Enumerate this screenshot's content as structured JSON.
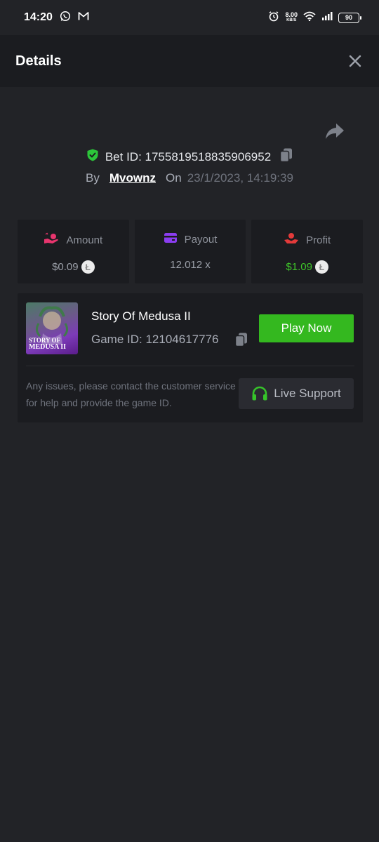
{
  "status_bar": {
    "time": "14:20",
    "net_speed": "8.00",
    "net_unit": "KB/S",
    "battery": "90",
    "icons": [
      "whatsapp-icon",
      "gmail-icon",
      "alarm-icon",
      "wifi-icon",
      "signal-icon",
      "battery-icon"
    ]
  },
  "header": {
    "title": "Details"
  },
  "bet": {
    "id_label": "Bet ID: 1755819518835906952",
    "by_label": "By",
    "username": "Mvownz",
    "on_label": "On",
    "datetime": "23/1/2023, 14:19:39"
  },
  "stats": [
    {
      "label": "Amount",
      "value": "$0.09",
      "icon": "money-hand-icon",
      "color": "#e8356e"
    },
    {
      "label": "Payout",
      "value": "12.012 x",
      "icon": "wallet-card-icon",
      "color": "#8b3df0"
    },
    {
      "label": "Profit",
      "value": "$1.09",
      "icon": "coin-hand-icon",
      "color": "#e33a3a"
    }
  ],
  "game": {
    "name": "Story Of Medusa II",
    "id_label": "Game ID: 12104617776",
    "thumb_line1": "STORY OF",
    "thumb_line2": "MEDUSA II",
    "play_label": "Play Now",
    "issues_text": "Any issues, please contact the customer service for help and provide the game ID.",
    "support_label": "Live Support"
  },
  "colors": {
    "accent_green": "#34b81f",
    "profit_green": "#3fc62a",
    "background": "#222327",
    "card": "#1b1c20"
  }
}
